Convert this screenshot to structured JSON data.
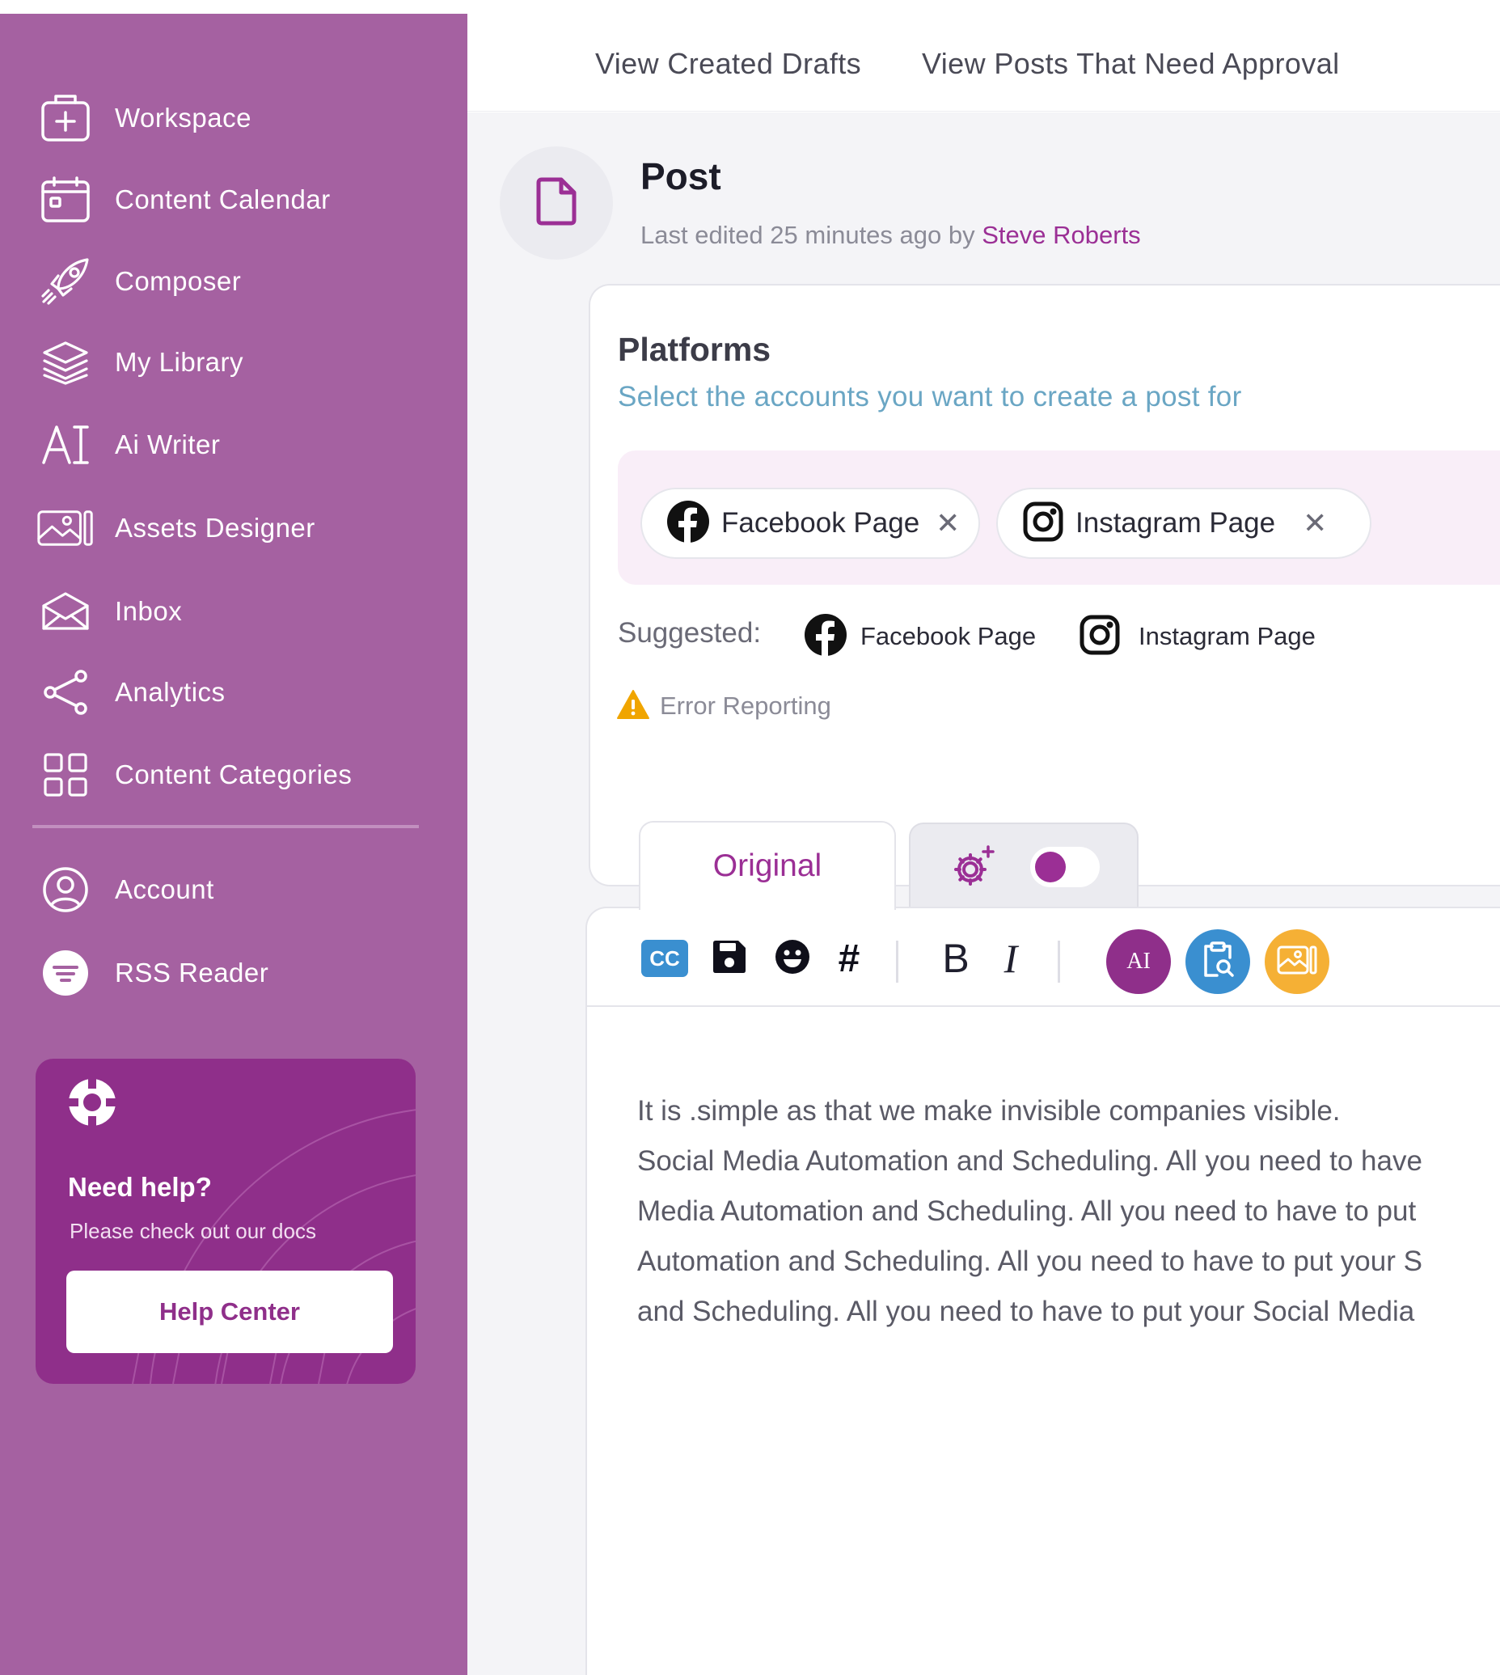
{
  "sidebar": {
    "items": [
      {
        "label": "Workspace",
        "icon": "workspace-plus-icon"
      },
      {
        "label": "Content Calendar",
        "icon": "calendar-icon"
      },
      {
        "label": "Composer",
        "icon": "rocket-icon"
      },
      {
        "label": "My Library",
        "icon": "layers-icon"
      },
      {
        "label": "Ai Writer",
        "icon": "ai-text-icon"
      },
      {
        "label": "Assets Designer",
        "icon": "image-designer-icon"
      },
      {
        "label": "Inbox",
        "icon": "envelope-icon"
      },
      {
        "label": "Analytics",
        "icon": "share-nodes-icon"
      },
      {
        "label": "Content Categories",
        "icon": "grid-icon"
      }
    ],
    "bottom_items": [
      {
        "label": "Account",
        "icon": "user-circle-icon"
      },
      {
        "label": "RSS Reader",
        "icon": "rss-filter-icon"
      }
    ],
    "help": {
      "title": "Need help?",
      "subtitle": "Please check out our docs",
      "button": "Help Center",
      "icon": "lifebuoy-icon"
    }
  },
  "topbar": {
    "links": [
      "View Created Drafts",
      "View Posts That Need Approval"
    ]
  },
  "post": {
    "title": "Post",
    "meta_prefix": "Last edited 25 minutes ago by",
    "author": "Steve Roberts",
    "icon": "document-icon"
  },
  "platforms": {
    "title": "Platforms",
    "subtitle": "Select the accounts you want to create a post for",
    "selected": [
      "Facebook Page",
      "Instagram Page"
    ],
    "suggested_label": "Suggested:",
    "suggested": [
      "Facebook Page",
      "Instagram Page"
    ],
    "error_label": "Error Reporting"
  },
  "tabs": {
    "original": "Original",
    "ai_toggle_on": true
  },
  "toolbar": {
    "cc_label": "CC",
    "hash_label": "#",
    "bold_label": "B",
    "italic_label": "I",
    "ai_label": "AI"
  },
  "editor": {
    "lines": [
      "It is .simple as that we make invisible companies visible.",
      "Social Media Automation and Scheduling. All you need to have",
      "Media Automation and Scheduling. All you need to have to put",
      "Automation and Scheduling. All you need to have to put your S",
      "and Scheduling. All you need to have to put your Social Media"
    ]
  },
  "colors": {
    "sidebar": "#a561a1",
    "accent": "#9b2f95",
    "help_card": "#8f2f8a",
    "subtitle_blue": "#6aa6c4",
    "warning": "#f0a500"
  }
}
